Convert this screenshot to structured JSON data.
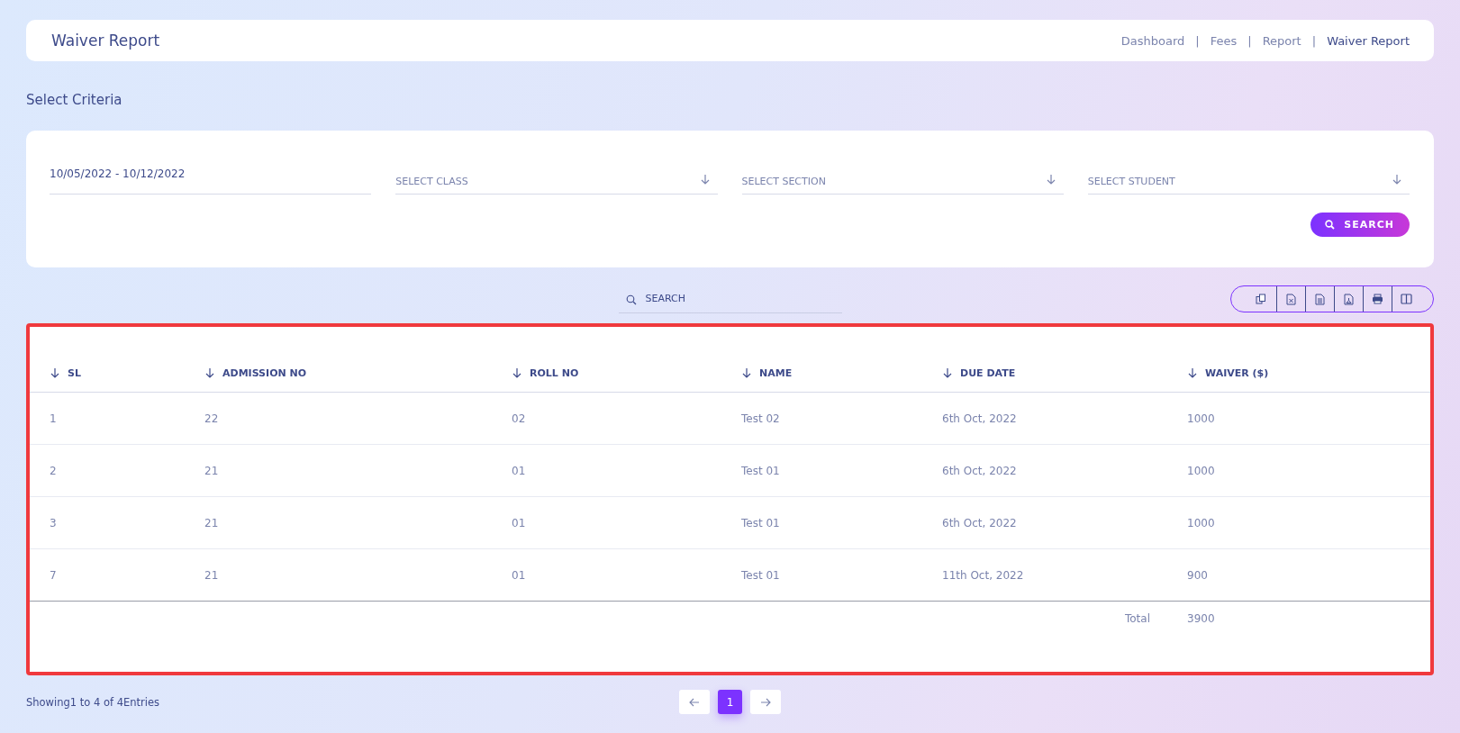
{
  "header": {
    "title": "Waiver Report",
    "breadcrumbs": [
      {
        "kind": "link",
        "label": "Dashboard",
        "current": false
      },
      {
        "kind": "separator",
        "label": "|"
      },
      {
        "kind": "link",
        "label": "Fees",
        "current": false
      },
      {
        "kind": "separator",
        "label": "|"
      },
      {
        "kind": "link",
        "label": "Report",
        "current": false
      },
      {
        "kind": "separator",
        "label": "|"
      },
      {
        "kind": "link",
        "label": "Waiver Report",
        "current": true
      }
    ]
  },
  "section_title": "Select Criteria",
  "filters": {
    "date_range": "10/05/2022 - 10/12/2022",
    "selects": [
      {
        "placeholder": "SELECT CLASS"
      },
      {
        "placeholder": "SELECT SECTION"
      },
      {
        "placeholder": "SELECT STUDENT"
      }
    ],
    "search_button": "SEARCH"
  },
  "table_search": {
    "placeholder": "SEARCH"
  },
  "export_buttons": [
    {
      "kind": "copy"
    },
    {
      "kind": "excel"
    },
    {
      "kind": "csv"
    },
    {
      "kind": "pdf"
    },
    {
      "kind": "print"
    },
    {
      "kind": "columns"
    }
  ],
  "table": {
    "columns": [
      "SL",
      "ADMISSION NO",
      "ROLL NO",
      "NAME",
      "DUE DATE",
      "WAIVER ($)"
    ],
    "rows": [
      [
        "1",
        "22",
        "02",
        "Test 02",
        "6th Oct, 2022",
        "1000"
      ],
      [
        "2",
        "21",
        "01",
        "Test 01",
        "6th Oct, 2022",
        "1000"
      ],
      [
        "3",
        "21",
        "01",
        "Test 01",
        "6th Oct, 2022",
        "1000"
      ],
      [
        "7",
        "21",
        "01",
        "Test 01",
        "11th Oct, 2022",
        "900"
      ]
    ],
    "total": {
      "label": "Total",
      "value": "3900"
    }
  },
  "footer": {
    "info": "Showing1 to 4 of 4Entries",
    "pages": [
      {
        "label": "1",
        "selected": true
      }
    ]
  }
}
